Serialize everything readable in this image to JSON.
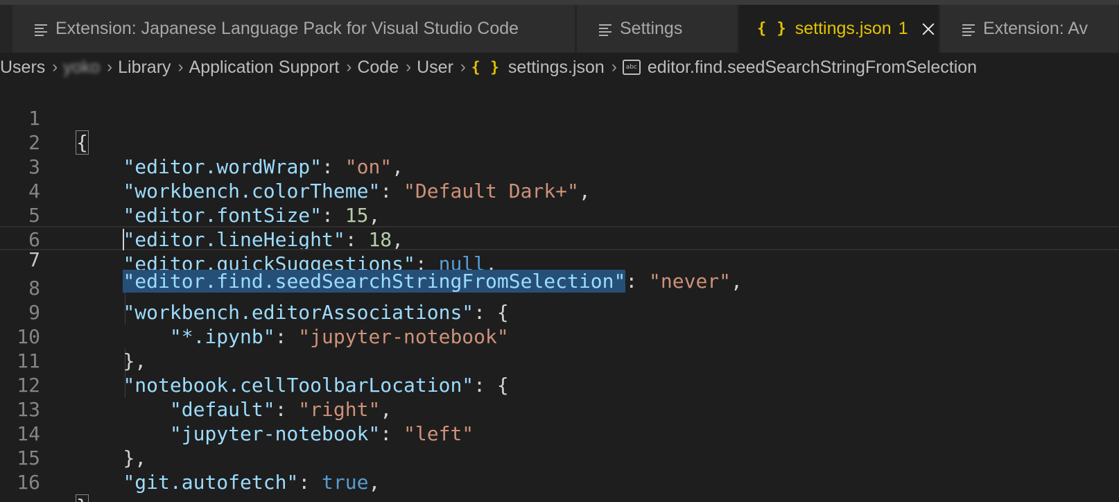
{
  "tabs": [
    {
      "label": "Extension: Japanese Language Pack for Visual Studio Code",
      "icon": "preview-icon"
    },
    {
      "label": "Settings",
      "icon": "preview-icon"
    },
    {
      "label": "settings.json",
      "icon": "json-braces-icon",
      "dirty_count": "1",
      "active": true
    },
    {
      "label": "Extension: Av",
      "icon": "preview-icon"
    }
  ],
  "breadcrumb": {
    "items": [
      "Users",
      "yoko",
      "Library",
      "Application Support",
      "Code",
      "User",
      "settings.json",
      "editor.find.seedSearchStringFromSelection"
    ],
    "json_icon": "{ }",
    "string_icon": "abc"
  },
  "editor": {
    "line_numbers": [
      "1",
      "2",
      "3",
      "4",
      "5",
      "6",
      "7",
      "8",
      "9",
      "10",
      "11",
      "12",
      "13",
      "14",
      "15",
      "16"
    ],
    "current_line": 7,
    "lines": {
      "l1": {
        "open": "{"
      },
      "l2": {
        "key": "\"editor.wordWrap\"",
        "colon": ": ",
        "value": "\"on\"",
        "end": ","
      },
      "l3": {
        "key": "\"workbench.colorTheme\"",
        "colon": ": ",
        "value": "\"Default Dark+\"",
        "end": ","
      },
      "l4": {
        "key": "\"editor.fontSize\"",
        "colon": ": ",
        "value": "15",
        "end": ","
      },
      "l5": {
        "key": "\"editor.lineHeight\"",
        "colon": ": ",
        "value": "18",
        "end": ","
      },
      "l6": {
        "key": "\"editor.quickSuggestions\"",
        "colon": ": ",
        "value": "null",
        "end": ","
      },
      "l7": {
        "key": "\"editor.find.seedSearchStringFromSelection\"",
        "colon": ": ",
        "value": "\"never\"",
        "end": ","
      },
      "l8": {
        "key": "\"workbench.editorAssociations\"",
        "colon": ": ",
        "value": "{"
      },
      "l9": {
        "key": "\"*.ipynb\"",
        "colon": ": ",
        "value": "\"jupyter-notebook\""
      },
      "l10": {
        "text": "},"
      },
      "l11": {
        "key": "\"notebook.cellToolbarLocation\"",
        "colon": ": ",
        "value": "{"
      },
      "l12": {
        "key": "\"default\"",
        "colon": ": ",
        "value": "\"right\"",
        "end": ","
      },
      "l13": {
        "key": "\"jupyter-notebook\"",
        "colon": ": ",
        "value": "\"left\""
      },
      "l14": {
        "text": "},"
      },
      "l15": {
        "key": "\"git.autofetch\"",
        "colon": ": ",
        "value": "true",
        "end": ","
      },
      "l16": {
        "close": "}"
      }
    }
  },
  "colors": {
    "background": "#1e1e1e",
    "tab_active_text": "#e3c300",
    "json_key": "#9cdcfe",
    "json_string": "#ce9178",
    "json_number": "#b5cea8",
    "json_keyword": "#569cd6"
  }
}
